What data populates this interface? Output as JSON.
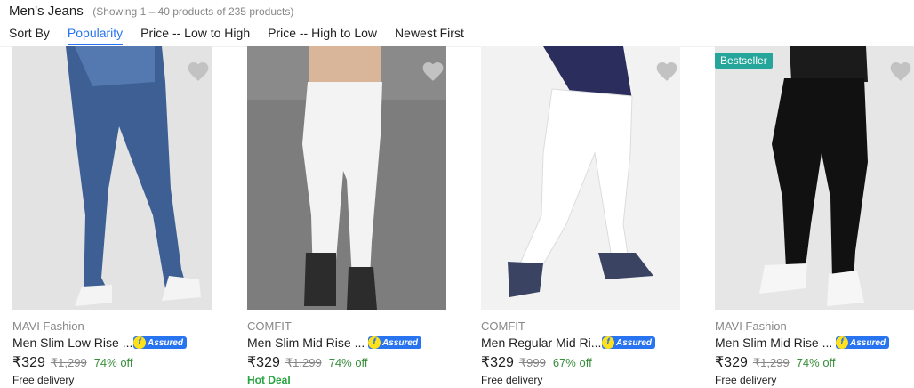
{
  "header": {
    "title": "Men's Jeans",
    "count": "(Showing 1 – 40 products of 235 products)"
  },
  "sort": {
    "label": "Sort By",
    "options": [
      "Popularity",
      "Price -- Low to High",
      "Price -- High to Low",
      "Newest First"
    ],
    "active": "Popularity"
  },
  "products": [
    {
      "brand": "MAVI Fashion",
      "name": "Men Slim Low Rise ...",
      "assured": "Assured",
      "price": "₹329",
      "mrp": "₹1,299",
      "off": "74% off",
      "delivery": "Free delivery",
      "image": "blue-denim-jeans"
    },
    {
      "brand": "COMFIT",
      "name": "Men Slim Mid Rise ...",
      "assured": "Assured",
      "price": "₹329",
      "mrp": "₹1,299",
      "off": "74% off",
      "delivery": "Hot Deal",
      "image": "white-jeans"
    },
    {
      "brand": "COMFIT",
      "name": "Men Regular Mid Ri...",
      "assured": "Assured",
      "price": "₹329",
      "mrp": "₹999",
      "off": "67% off",
      "delivery": "Free delivery",
      "image": "white-jeans"
    },
    {
      "brand": "MAVI Fashion",
      "name": "Men Slim Mid Rise ...",
      "assured": "Assured",
      "price": "₹329",
      "mrp": "₹1,299",
      "off": "74% off",
      "delivery": "Free delivery",
      "badge": "Bestseller",
      "image": "black-jeans"
    }
  ],
  "colors": {
    "accent": "#2874f0",
    "discount": "#388e3c",
    "hot_deal": "#26a541",
    "badge": "#26a69a"
  }
}
